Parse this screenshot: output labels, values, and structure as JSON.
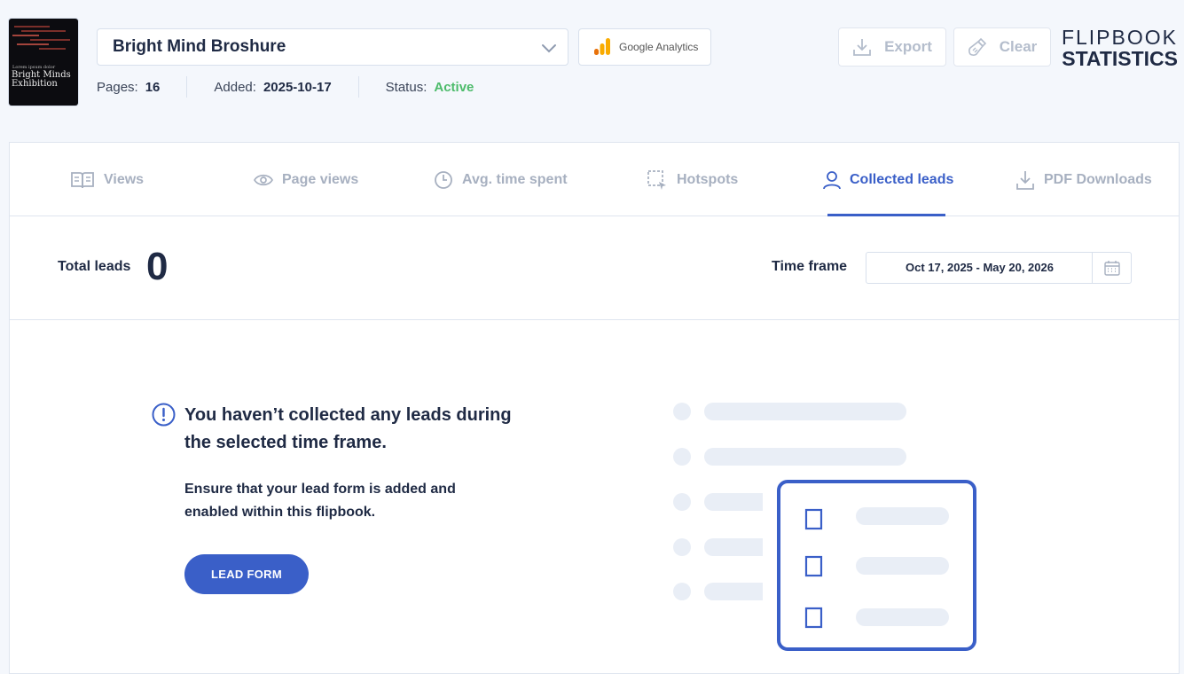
{
  "flipbook": {
    "thumbnail_title": "Bright Minds Exhibition",
    "thumbnail_small": "Lorem ipsum dolor",
    "selected_name": "Bright Mind Broshure"
  },
  "google_analytics": {
    "label": "Google Analytics"
  },
  "meta": {
    "pages_label": "Pages:",
    "pages_value": "16",
    "added_label": "Added:",
    "added_value": "2025-10-17",
    "status_label": "Status:",
    "status_value": "Active"
  },
  "toolbar": {
    "export_label": "Export",
    "clear_label": "Clear"
  },
  "brand": {
    "line1": "FLIPBOOK",
    "line2": "STATISTICS"
  },
  "tabs": [
    {
      "label": "Views",
      "icon": "book-icon"
    },
    {
      "label": "Page views",
      "icon": "eye-icon"
    },
    {
      "label": "Avg. time spent",
      "icon": "clock-icon"
    },
    {
      "label": "Hotspots",
      "icon": "hotspot-icon"
    },
    {
      "label": "Collected leads",
      "icon": "user-icon",
      "active": true
    },
    {
      "label": "PDF Downloads",
      "icon": "download-icon"
    }
  ],
  "totals": {
    "total_label": "Total leads",
    "total_value": "0",
    "timeframe_label": "Time frame",
    "timeframe_value": "Oct 17, 2025 - May 20, 2026"
  },
  "empty_state": {
    "title": "You haven’t collected any leads during the selected time frame.",
    "description": "Ensure that your lead form is added and enabled within this flipbook.",
    "button_label": "LEAD FORM"
  },
  "colors": {
    "accent": "#3a5fc8",
    "active_status": "#4cbb6a",
    "text": "#1f2a44",
    "muted": "#a7b0c0"
  }
}
